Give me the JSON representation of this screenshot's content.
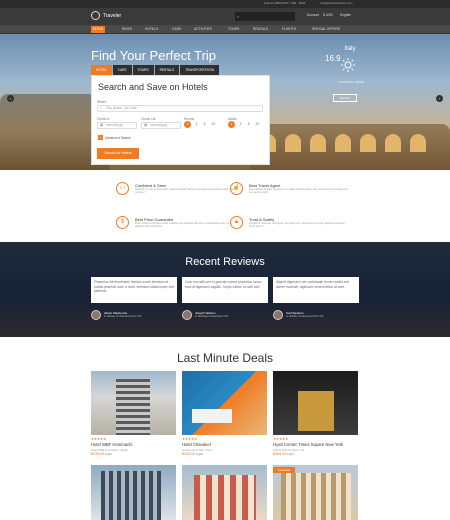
{
  "topbar": {
    "left": "Call us (0800) 899 - 999 - 8991",
    "right": "Info@travel.themes.com"
  },
  "header": {
    "brand": "Traveler",
    "currency": "$ USD",
    "language": "English",
    "account": "Account"
  },
  "nav": [
    "HOME",
    "RIDES",
    "HOTELS",
    "CARS",
    "ACTIVITIES",
    "TOURS",
    "RENTALS",
    "FLIGHTS",
    "SPECIAL OFFERS"
  ],
  "hero": {
    "title": "Find Your Perfect Trip",
    "tabs": [
      "HOTEL",
      "CARS",
      "TOURS",
      "RENTALS",
      "TRANSPORTATION"
    ],
    "weather": {
      "city": "Italy",
      "temp": "16.9",
      "note": "7:12 AM Tue, 28 Mar"
    },
    "weather_button": "Explore"
  },
  "search": {
    "title": "Search and Save on Hotels",
    "where_label": "Where",
    "where_placeholder": "City, Airport, Zip Code",
    "checkin_label": "Check in",
    "checkin_placeholder": "mm/dd/yyyy",
    "checkout_label": "Check out",
    "checkout_placeholder": "mm/dd/yyyy",
    "rooms_label": "Rooms",
    "rooms": [
      "1",
      "2",
      "3",
      "3+"
    ],
    "adults_label": "Adults",
    "adults": [
      "1",
      "2",
      "3",
      "3+"
    ],
    "advanced": "Advanced Search",
    "button": "Search for Hotels"
  },
  "features": [
    {
      "title": "Confident & Save",
      "desc": "Nostrud ut nunc et duis dolor magna fringilla. Tellus commodo egestas felis morbi risus nec sem."
    },
    {
      "title": "Best Travel Agent",
      "desc": "Non ultricies id dolor semper ut ut mollis posuere tellus. Dui porta pretium congue sed, non sem tempor."
    },
    {
      "title": "Best Price Guarantee",
      "desc": "Proin sociis ac fringilla mollis molestie per nascetur dictumst. Consectetur eget mi in aliquam nam sed porta."
    },
    {
      "title": "Trust & Safety",
      "desc": "Porttitor a mus quis velit ligula, nec eget orci. Sed aenean at nibh dapibus hendrerit fusce quis ut."
    }
  ],
  "reviews": {
    "title": "Recent Reviews",
    "items": [
      {
        "quote": "Phasellus elit fermentum facilisis sociis interdum et cubilia placerat nunc a nulla. Interdum ullamcorper sed placerat.",
        "name": "Alison Mackenzie",
        "loc": "in Holiday Inn Express New York"
      },
      {
        "quote": "Cras convallis per in gravida viverra phasellus luctus eros at dignissim sagittis. Turpis rutrum ut odio sed.",
        "name": "Joseph Watson",
        "loc": "in Wellington Hotel New York"
      },
      {
        "quote": "Aliquet dignissim nec sollicitudin ferme cubilia sed donec molestie, dignissim viverra tellus at ante.",
        "name": "Carl Sanders",
        "loc": "in Holiday Inn Express New York"
      }
    ]
  },
  "deals": {
    "title": "Last Minute Deals",
    "items": [
      {
        "name": "Hotel WBF Hommachi",
        "addr": "Hotel WBF Hommachi, Japan",
        "price": "$235.00",
        "unit": "/night",
        "stars": "★★★★★"
      },
      {
        "name": "Hotel Chavanel",
        "addr": "22 Rue de la Paix, Paris",
        "price": "$434.00",
        "unit": "/night",
        "stars": "★★★★★"
      },
      {
        "name": "Hyatt Centric Times Square New York",
        "addr": "135 W 45th St, New York",
        "price": "$384.00",
        "unit": "/night",
        "stars": "★★★★★"
      }
    ],
    "ribbon": "Featured"
  },
  "colors": {
    "accent": "#f07b22",
    "dark": "#3a3a3a"
  }
}
